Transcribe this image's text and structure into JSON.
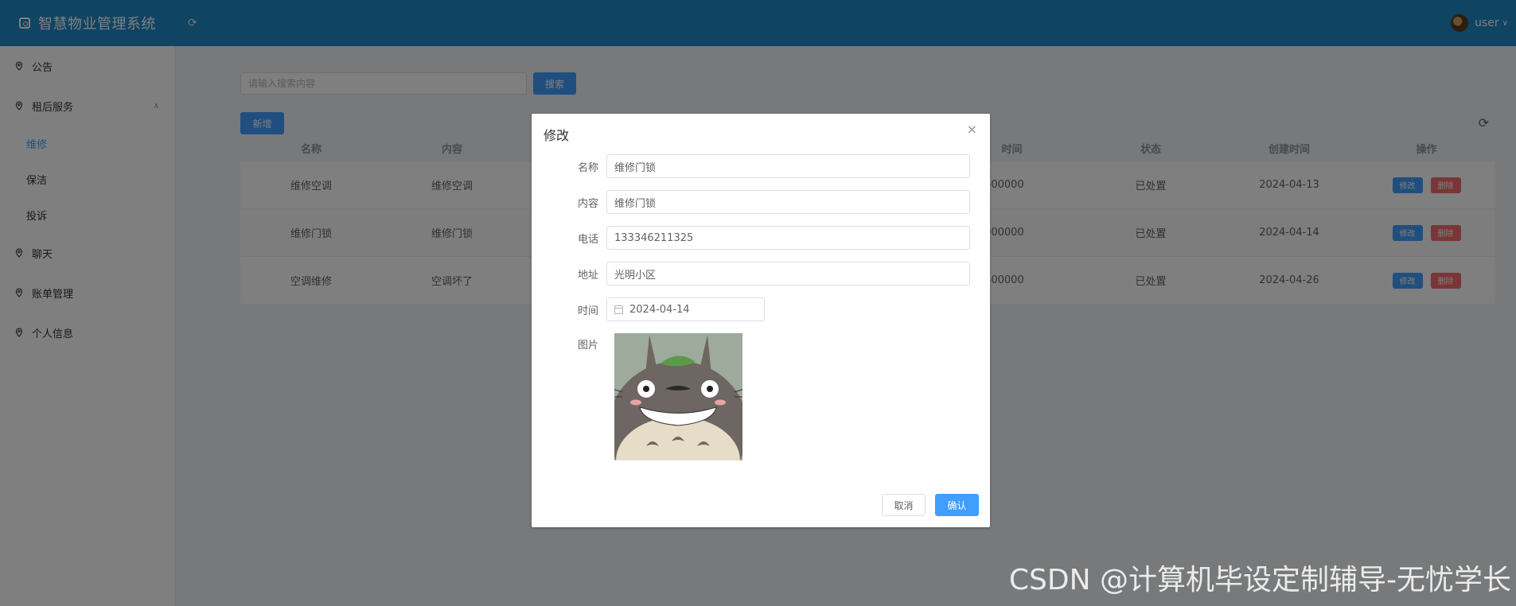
{
  "header": {
    "app_title": "智慧物业管理系统",
    "username": "user",
    "accent": "#1e88c7"
  },
  "sidebar": {
    "items": [
      {
        "label": "公告",
        "icon": "location-icon"
      },
      {
        "label": "租后服务",
        "icon": "location-icon",
        "expanded": true,
        "children": [
          {
            "label": "维修",
            "active": true
          },
          {
            "label": "保洁"
          },
          {
            "label": "投诉"
          }
        ]
      },
      {
        "label": "聊天",
        "icon": "location-icon"
      },
      {
        "label": "账单管理",
        "icon": "location-icon"
      },
      {
        "label": "个人信息",
        "icon": "location-icon"
      }
    ]
  },
  "toolbar": {
    "search_placeholder": "请输入搜索内容",
    "search_label": "搜索",
    "add_label": "新增"
  },
  "table": {
    "headers": [
      "名称",
      "内容",
      "",
      "",
      "",
      "时间",
      "状态",
      "创建时间",
      "操作"
    ],
    "rows": [
      {
        "name": "维修空调",
        "content": "维修空调",
        "time": "3369600000",
        "status": "已处置",
        "created": "2024-04-13"
      },
      {
        "name": "维修门锁",
        "content": "维修门锁",
        "time": "3024000000",
        "status": "已处置",
        "created": "2024-04-14"
      },
      {
        "name": "空调维修",
        "content": "空调坏了",
        "time": "4060800000",
        "status": "已处置",
        "created": "2024-04-26"
      }
    ],
    "edit_label": "修改",
    "delete_label": "删除"
  },
  "dialog": {
    "title": "修改",
    "fields": {
      "name_label": "名称",
      "name_value": "维修门锁",
      "content_label": "内容",
      "content_value": "维修门锁",
      "phone_label": "电话",
      "phone_value": "133346211325",
      "address_label": "地址",
      "address_value": "光明小区",
      "time_label": "时间",
      "time_value": "2024-04-14",
      "image_label": "图片"
    },
    "cancel_label": "取消",
    "confirm_label": "确认"
  },
  "watermark": "CSDN @计算机毕设定制辅导-无忧学长"
}
